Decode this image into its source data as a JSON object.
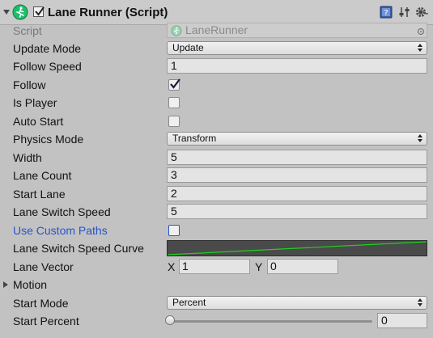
{
  "component": {
    "title": "Lane Runner (Script)",
    "enabled": true,
    "accent_color": "#1fbf6a"
  },
  "fields": {
    "script": {
      "label": "Script",
      "value": "LaneRunner"
    },
    "update_mode": {
      "label": "Update Mode",
      "value": "Update"
    },
    "follow_speed": {
      "label": "Follow Speed",
      "value": "1"
    },
    "follow": {
      "label": "Follow",
      "checked": true
    },
    "is_player": {
      "label": "Is Player",
      "checked": false
    },
    "auto_start": {
      "label": "Auto Start",
      "checked": false
    },
    "physics_mode": {
      "label": "Physics Mode",
      "value": "Transform"
    },
    "width": {
      "label": "Width",
      "value": "5"
    },
    "lane_count": {
      "label": "Lane Count",
      "value": "3"
    },
    "start_lane": {
      "label": "Start Lane",
      "value": "2"
    },
    "lane_switch_speed": {
      "label": "Lane Switch Speed",
      "value": "5"
    },
    "use_custom_paths": {
      "label": "Use Custom Paths",
      "checked": false
    },
    "lane_switch_speed_curve": {
      "label": "Lane Switch Speed Curve",
      "curve_color": "#1fd11f"
    },
    "lane_vector": {
      "label": "Lane Vector",
      "x_label": "X",
      "x_value": "1",
      "y_label": "Y",
      "y_value": "0"
    },
    "motion": {
      "label": "Motion",
      "expanded": false
    },
    "start_mode": {
      "label": "Start Mode",
      "value": "Percent"
    },
    "start_percent": {
      "label": "Start Percent",
      "value": "0",
      "slider_fraction": 0
    }
  },
  "icons": {
    "component": "lane-runner-script-icon",
    "help": "help-book-icon",
    "presets": "presets-sliders-icon",
    "settings": "gear-icon"
  }
}
